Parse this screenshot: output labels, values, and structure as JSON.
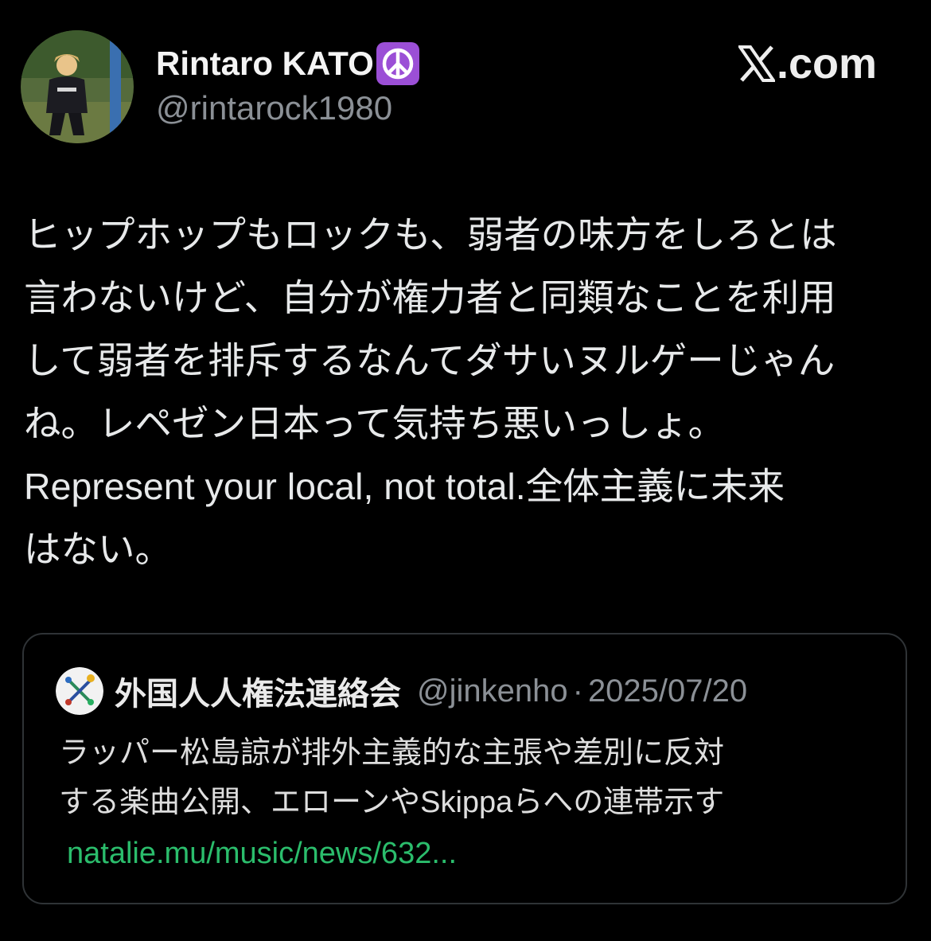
{
  "author": {
    "display_name": "Rintaro KATO",
    "badge_icon": "peace-symbol-icon",
    "handle": "@rintarock1980"
  },
  "site_logo": {
    "icon": "x-logo-icon",
    "label": ".com"
  },
  "tweet": {
    "text": "ヒップホップもロックも、弱者の味方をしろとは\n言わないけど、自分が権力者と同類なことを利用\nして弱者を排斥するなんてダサいヌルゲーじゃん\nね。レペゼン日本って気持ち悪いっしょ。\nRepresent your local, not total.全体主義に未来\nはない。"
  },
  "quoted_tweet": {
    "avatar_icon": "organization-logo-icon",
    "display_name": "外国人人権法連絡会",
    "handle": "@jinkenho",
    "separator": "·",
    "date": "2025/07/20",
    "text": "ラッパー松島諒が排外主義的な主張や差別に反対\nする楽曲公開、エローンやSkippaらへの連帯示す",
    "link": "natalie.mu/music/news/632..."
  },
  "colors": {
    "background": "#000000",
    "primary_text": "#e7e9ea",
    "secondary_text": "#8b9096",
    "link": "#2bbd6c",
    "card_border": "#2f3336",
    "badge": "#9b4fd6"
  }
}
